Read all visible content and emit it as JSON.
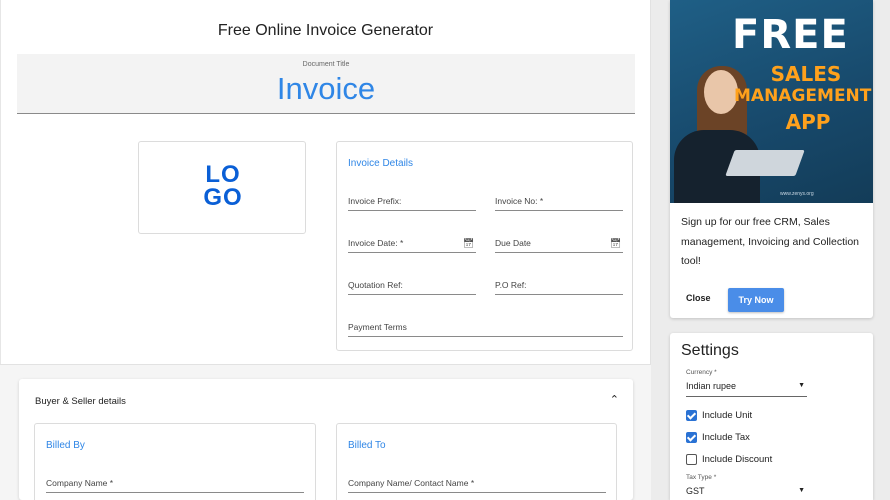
{
  "page_title": "Free Online Invoice Generator",
  "document_title": {
    "caption": "Document Title",
    "value": "Invoice"
  },
  "logo": {
    "text_top": "LO",
    "text_bottom": "GO"
  },
  "invoice_details": {
    "heading": "Invoice Details",
    "invoice_prefix": "Invoice Prefix:",
    "invoice_no": "Invoice No: *",
    "invoice_date": "Invoice Date: *",
    "due_date": "Due Date",
    "quotation_ref": "Quotation Ref:",
    "po_ref": "P.O Ref:",
    "payment_terms": "Payment Terms"
  },
  "buyer_seller": {
    "title": "Buyer & Seller details",
    "billed_by": {
      "heading": "Billed By",
      "company_name": "Company Name *"
    },
    "billed_to": {
      "heading": "Billed To",
      "company_name": "Company Name/ Contact Name *"
    }
  },
  "ad": {
    "headline": "FREE",
    "line1": "SALES",
    "line2": "MANAGEMENT",
    "line3": "APP",
    "url": "www.zenys.org",
    "description": "Sign up for our free CRM, Sales management, Invoicing and Collection tool!",
    "close_label": "Close",
    "cta_label": "Try Now",
    "colors": {
      "background": "#1f5f86",
      "accent": "#ffa11c",
      "button": "#4a8de8"
    }
  },
  "settings": {
    "title": "Settings",
    "currency": {
      "caption": "Currency *",
      "value": "Indian rupee"
    },
    "checkboxes": [
      {
        "label": "Include Unit",
        "checked": true
      },
      {
        "label": "Include Tax",
        "checked": true
      },
      {
        "label": "Include Discount",
        "checked": false
      }
    ],
    "tax_type": {
      "caption": "Tax Type *",
      "value": "GST"
    }
  },
  "icons": {
    "calendar": "calendar-icon",
    "chevron_up": "chevron-up-icon",
    "dropdown": "dropdown-arrow-icon"
  },
  "colors": {
    "accent_blue": "#2f86e6",
    "checkbox_blue": "#2a72d4"
  }
}
